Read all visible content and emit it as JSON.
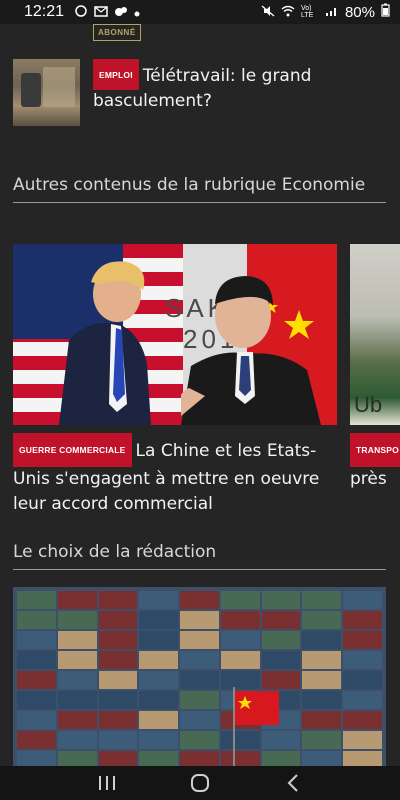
{
  "status_bar": {
    "time": "12:21",
    "network_label": "Vo) LTE",
    "battery": "80%"
  },
  "badges": {
    "abonne": "ABONNÉ"
  },
  "top_article": {
    "tag": "EMPLOI",
    "title": "Télétravail: le grand basculement?"
  },
  "section_related": {
    "title": "Autres contenus de la rubrique Economie"
  },
  "carousel": {
    "main_card": {
      "tag": "GUERRE COMMERCIALE",
      "title": "La Chine et les Etats-Unis s'engagent à mettre en oeuvre leur accord commercial",
      "backdrop_text": "SAK\n201"
    },
    "peek_card": {
      "tag": "TRANSPO",
      "title": "près",
      "photo_text": "Ub"
    }
  },
  "section_editorial": {
    "title": "Le choix de la rédaction"
  },
  "colors": {
    "background": "#252525",
    "tag_red": "#c0132a",
    "badge_gold": "#b8a25a"
  }
}
